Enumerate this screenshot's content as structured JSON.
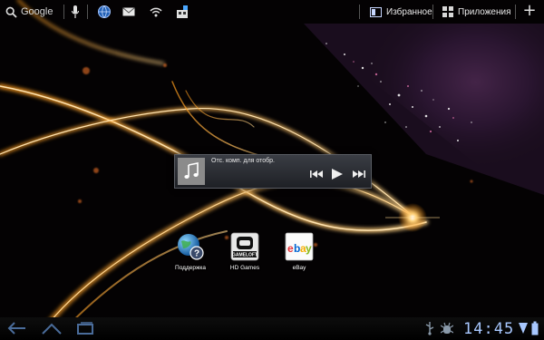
{
  "statusbar": {
    "search_label": "Google",
    "favorites_label": "Избранное",
    "apps_label": "Приложения",
    "add_label": "+"
  },
  "music_widget": {
    "track_text": "Отс. комп. для отобр."
  },
  "apps": [
    {
      "label": "Поддержка",
      "icon": "support-globe-icon"
    },
    {
      "label": "HD Games",
      "icon": "gameloft-icon",
      "icon_text": "GAMELOFT"
    },
    {
      "label": "eBay",
      "icon": "ebay-icon"
    }
  ],
  "system_bar": {
    "clock": "14:45"
  },
  "colors": {
    "clock": "#a8c8ff",
    "light_streak": "#ffb02e",
    "ebay_e": "#e53238",
    "ebay_b": "#0064d2",
    "ebay_a": "#f5af02",
    "ebay_y": "#86b817"
  }
}
